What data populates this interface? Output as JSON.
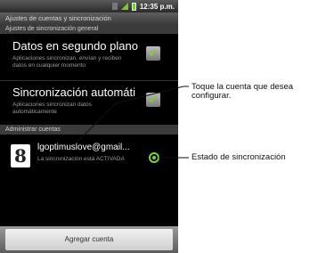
{
  "status_bar": {
    "time": "12:35 p.m.",
    "icons": [
      "signal-icon",
      "network-bars-icon",
      "battery-icon"
    ]
  },
  "screen": {
    "title": "Ajustes de cuentas y sincronización",
    "general_section": "Ajustes de sincronización general",
    "background_data": {
      "title": "Datos en segundo plano",
      "description": "Aplicaciones sincronizan, envían y reciben datos en cualquier momento",
      "checked": true
    },
    "auto_sync": {
      "title": "Sincronización automáti",
      "description": "Aplicaciones sincronizan datos automáticamente",
      "checked": true
    },
    "accounts_section": "Administrar cuentas",
    "account": {
      "logo": "8",
      "email": "lgoptimuslove@gmail...",
      "status": "La sincronización está ACTIVADA"
    },
    "add_account_button": "Agregar cuenta"
  },
  "callouts": {
    "account": "Toque la cuenta que desea configurar.",
    "sync_status": "Estado de sincronización"
  },
  "colors": {
    "accent_green": "#7cd12a",
    "background": "#000000"
  }
}
